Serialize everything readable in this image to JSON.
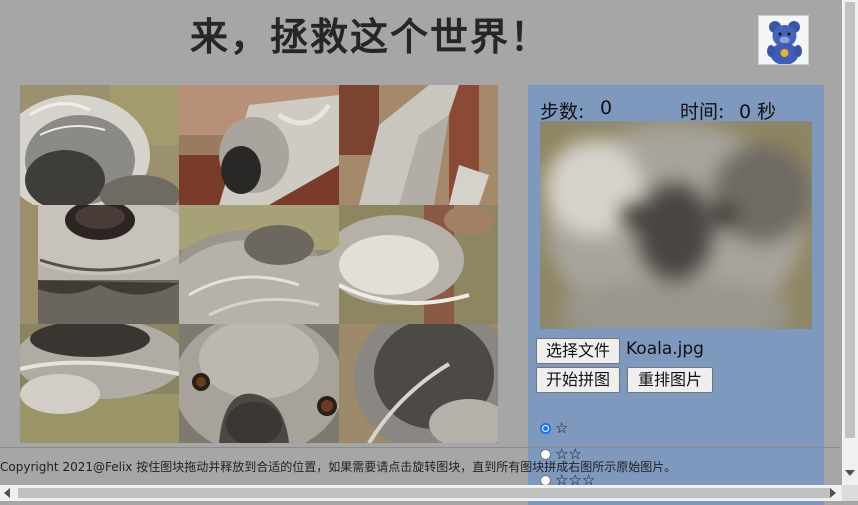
{
  "header": {
    "title": "来，拯救这个世界！"
  },
  "panel": {
    "steps_label": "步数:",
    "steps_value": "0",
    "time_label": "时间:",
    "time_value": "0 秒",
    "file_button": "选择文件",
    "file_name": "Koala.jpg",
    "start_button": "开始拼图",
    "shuffle_button": "重排图片",
    "difficulty_options": [
      {
        "label": "☆",
        "checked": true
      },
      {
        "label": "☆☆",
        "checked": false
      },
      {
        "label": "☆☆☆",
        "checked": false
      }
    ]
  },
  "footer": {
    "text": "Copyright 2021@Felix 按住图块拖动并释放到合适的位置，如果需要请点击旋转图块，直到所有图块拼成右图所示原始图片。"
  },
  "puzzle": {
    "rows": 3,
    "cols": 3,
    "tiles": [
      {
        "name": "tile-1",
        "icon": "koala-ear-fur"
      },
      {
        "name": "tile-2",
        "icon": "koala-paw-branch"
      },
      {
        "name": "tile-3",
        "icon": "koala-arm-branch"
      },
      {
        "name": "tile-4",
        "icon": "koala-nose-mouth"
      },
      {
        "name": "tile-5",
        "icon": "koala-fur"
      },
      {
        "name": "tile-6",
        "icon": "koala-ear-tuft"
      },
      {
        "name": "tile-7",
        "icon": "koala-chin-fur"
      },
      {
        "name": "tile-8",
        "icon": "koala-eyes-nose"
      },
      {
        "name": "tile-9",
        "icon": "koala-ear-dark"
      }
    ]
  },
  "colors": {
    "page_bg": "#a6a6a6",
    "panel_bg": "#7f98bd",
    "radio_accent": "#1a73e8"
  }
}
